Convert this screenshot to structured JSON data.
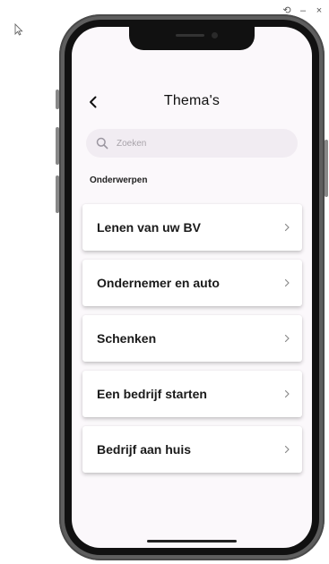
{
  "window": {
    "controls": {
      "history_glyph": "⟲",
      "minimize_glyph": "–",
      "close_glyph": "×"
    }
  },
  "header": {
    "title": "Thema's",
    "back_icon": "chevron-left-icon"
  },
  "search": {
    "placeholder": "Zoeken",
    "value": "",
    "icon": "search-icon"
  },
  "section": {
    "label": "Onderwerpen"
  },
  "topics": [
    {
      "label": "Lenen van uw BV"
    },
    {
      "label": "Ondernemer en auto"
    },
    {
      "label": "Schenken"
    },
    {
      "label": "Een bedrijf starten"
    },
    {
      "label": "Bedrijf aan huis"
    }
  ],
  "colors": {
    "screen_background": "#fbf8fb",
    "search_background": "#f1ecf2",
    "card_background": "#ffffff",
    "text_primary": "#1a1a1a"
  }
}
